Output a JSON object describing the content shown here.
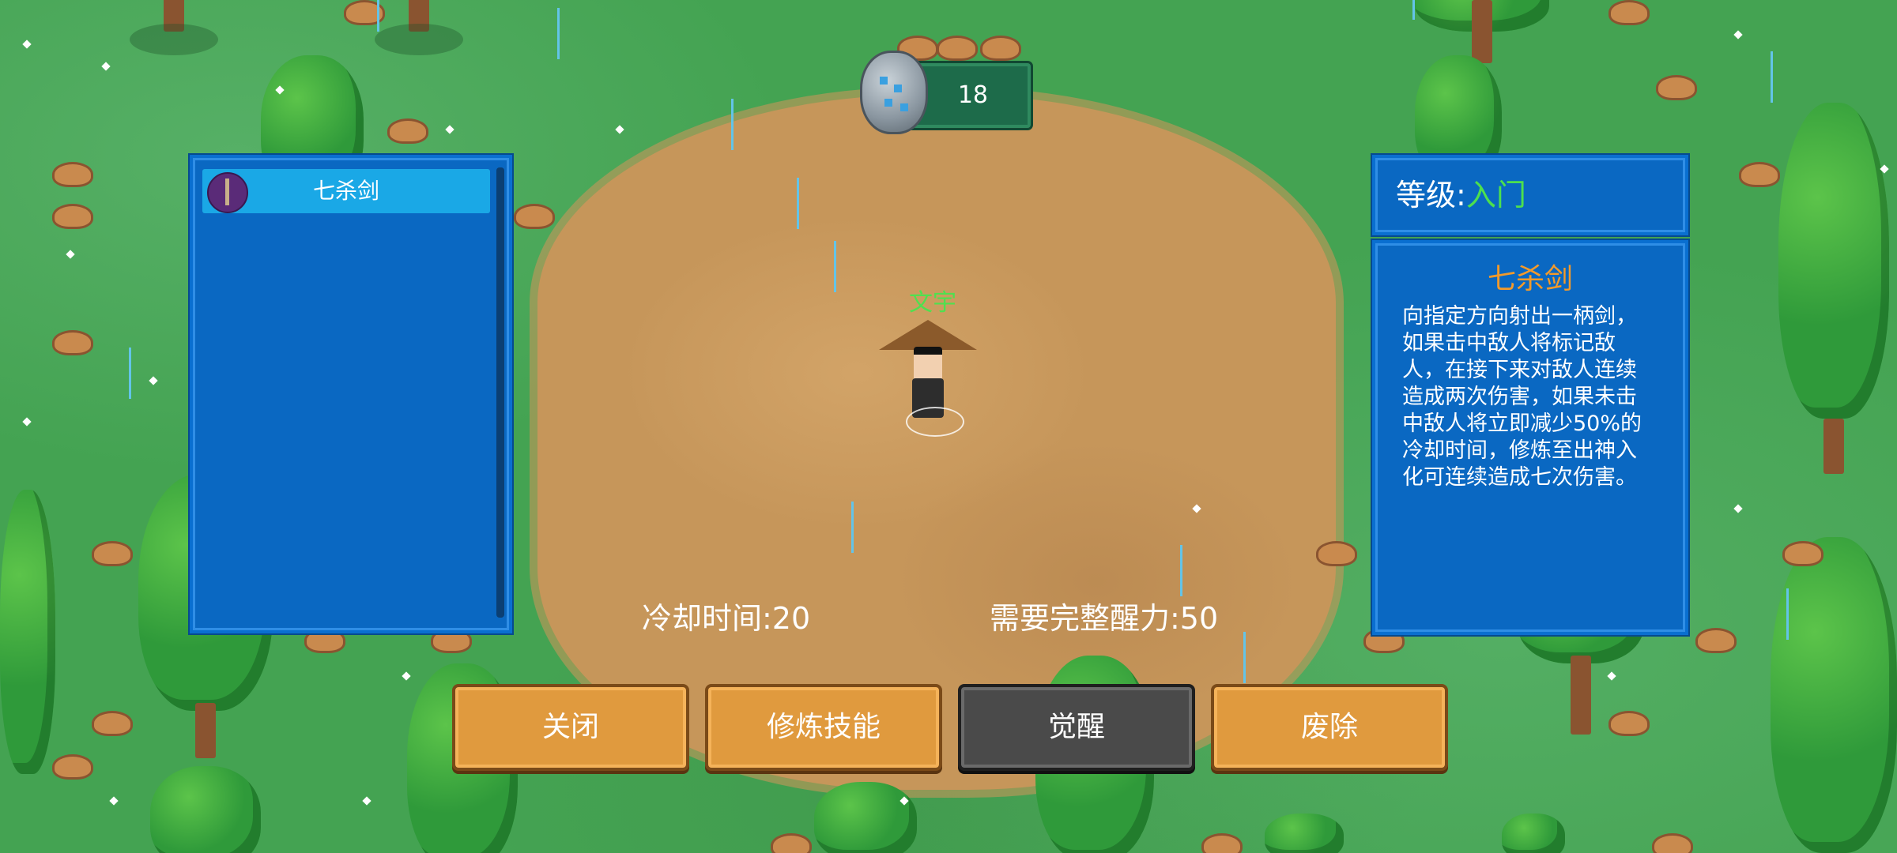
{
  "currency": {
    "count": "18",
    "icon": "ore-icon"
  },
  "character": {
    "name": "文宇"
  },
  "skill_list": {
    "items": [
      {
        "label": "七杀剑",
        "icon": "sword-icon"
      }
    ]
  },
  "level": {
    "label": "等级:",
    "value": "入门"
  },
  "skill_detail": {
    "name": "七杀剑",
    "description": "向指定方向射出一柄剑，如果击中敌人将标记敌人，在接下来对敌人连续造成两次伤害，如果未击中敌人将立即减少50%的冷却时间，修炼至出神入化可连续造成七次伤害。"
  },
  "stats": {
    "cooldown": "冷却时间:20",
    "awaken_requirement": "需要完整醒力:50"
  },
  "buttons": {
    "close": "关闭",
    "train": "修炼技能",
    "awaken": "觉醒",
    "remove": "废除"
  },
  "colors": {
    "panel_blue": "#0a68c2",
    "selected_item": "#1aa8e6",
    "button_orange": "#e09a3e",
    "button_disabled": "#4a4a4a",
    "level_green": "#4de04d",
    "title_orange": "#f39a2a"
  }
}
